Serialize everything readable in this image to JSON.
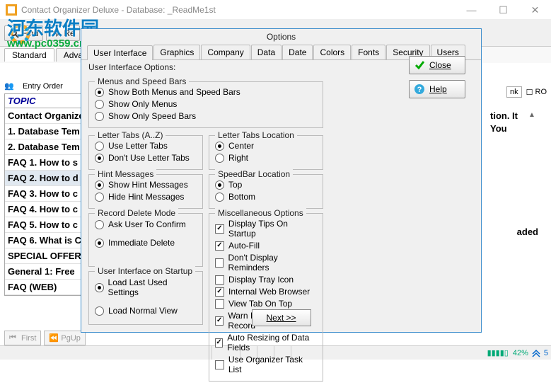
{
  "window": {
    "title": "Contact Organizer Deluxe - Database: _ReadMe1st"
  },
  "watermark": {
    "cn": "河东软件园",
    "url": "www.pc0359.cn"
  },
  "toolbar": {
    "find": "Find",
    "re": "Re"
  },
  "sub_tabs": [
    "Standard",
    "Advanced"
  ],
  "entry_order": "Entry Order",
  "topic_header": "TOPIC",
  "topics": [
    "Contact Organize",
    "1. Database Tem",
    "2. Database Tem",
    "FAQ 1. How to s",
    "FAQ 2. How to d",
    "FAQ 3. How to c",
    "FAQ 4. How to c",
    "FAQ 5. How to c",
    "FAQ 6. What is C",
    "SPECIAL OFFER",
    "General 1: Free",
    "FAQ (WEB)"
  ],
  "right_snips": {
    "a": "tion. It",
    "b": "You",
    "c": "aded"
  },
  "nk": {
    "label": "nk",
    "ro": "RO"
  },
  "dialog": {
    "title": "Options",
    "tabs": [
      "User Interface",
      "Graphics",
      "Company",
      "Data",
      "Date",
      "Colors",
      "Fonts",
      "Security",
      "Users"
    ],
    "heading": "User Interface Options:",
    "groups": {
      "menus": {
        "legend": "Menus and Speed Bars",
        "opts": [
          "Show Both Menus and Speed Bars",
          "Show Only Menus",
          "Show Only Speed Bars"
        ],
        "sel": 0
      },
      "letter_tabs": {
        "legend": "Letter Tabs (A..Z)",
        "opts": [
          "Use Letter Tabs",
          "Don't Use Letter Tabs"
        ],
        "sel": 1
      },
      "letter_loc": {
        "legend": "Letter Tabs Location",
        "opts": [
          "Center",
          "Right"
        ],
        "sel": 0
      },
      "hint": {
        "legend": "Hint Messages",
        "opts": [
          "Show Hint Messages",
          "Hide Hint Messages"
        ],
        "sel": 0
      },
      "speedbar_loc": {
        "legend": "SpeedBar Location",
        "opts": [
          "Top",
          "Bottom"
        ],
        "sel": 0
      },
      "delete_mode": {
        "legend": "Record Delete Mode",
        "opts": [
          "Ask User To Confirm",
          "Immediate Delete"
        ],
        "sel": 1
      },
      "startup": {
        "legend": "User Interface on Startup",
        "opts": [
          "Load Last Used Settings",
          "Load Normal View"
        ],
        "sel": 0
      },
      "misc": {
        "legend": "Miscellaneous Options",
        "items": [
          {
            "label": "Display Tips On Startup",
            "checked": true
          },
          {
            "label": "Auto-Fill",
            "checked": true
          },
          {
            "label": "Don't Display Reminders",
            "checked": false
          },
          {
            "label": "Display Tray Icon",
            "checked": false
          },
          {
            "label": "Internal Web Browser",
            "checked": true
          },
          {
            "label": "View Tab On Top",
            "checked": false
          },
          {
            "label": "Warn If Duplicate Record",
            "checked": true
          },
          {
            "label": "Auto Resizing of Data Fields",
            "checked": true
          },
          {
            "label": "Use Organizer Task List",
            "checked": false
          }
        ]
      }
    },
    "buttons": {
      "close": "Close",
      "help": "Help",
      "next": "Next >>"
    }
  },
  "bottom": {
    "first": "First",
    "pgup": "PgUp"
  },
  "status": {
    "pct": "42%",
    "size": "5"
  }
}
